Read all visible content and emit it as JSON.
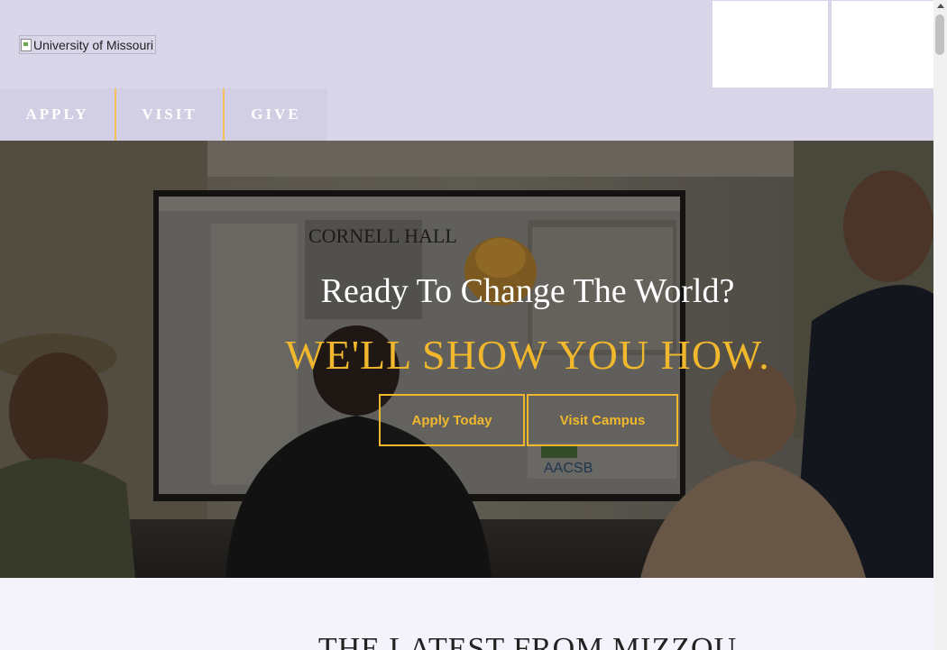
{
  "header": {
    "logo_alt": "University of Missouri"
  },
  "topnav": {
    "items": [
      {
        "label": "APPLY"
      },
      {
        "label": "VISIT"
      },
      {
        "label": "GIVE"
      }
    ]
  },
  "hero": {
    "title": "Ready To Change The World?",
    "subtitle": "WE'LL SHOW YOU HOW.",
    "buttons": [
      {
        "label": "Apply Today"
      },
      {
        "label": "Visit Campus"
      }
    ],
    "screen_text": {
      "heading": "CORNELL HALL",
      "logo": "AACSB"
    }
  },
  "section": {
    "title": "THE LATEST FROM MIZZOU"
  },
  "colors": {
    "gold": "#f1b82d",
    "nav_background": "#d9d6ea"
  }
}
